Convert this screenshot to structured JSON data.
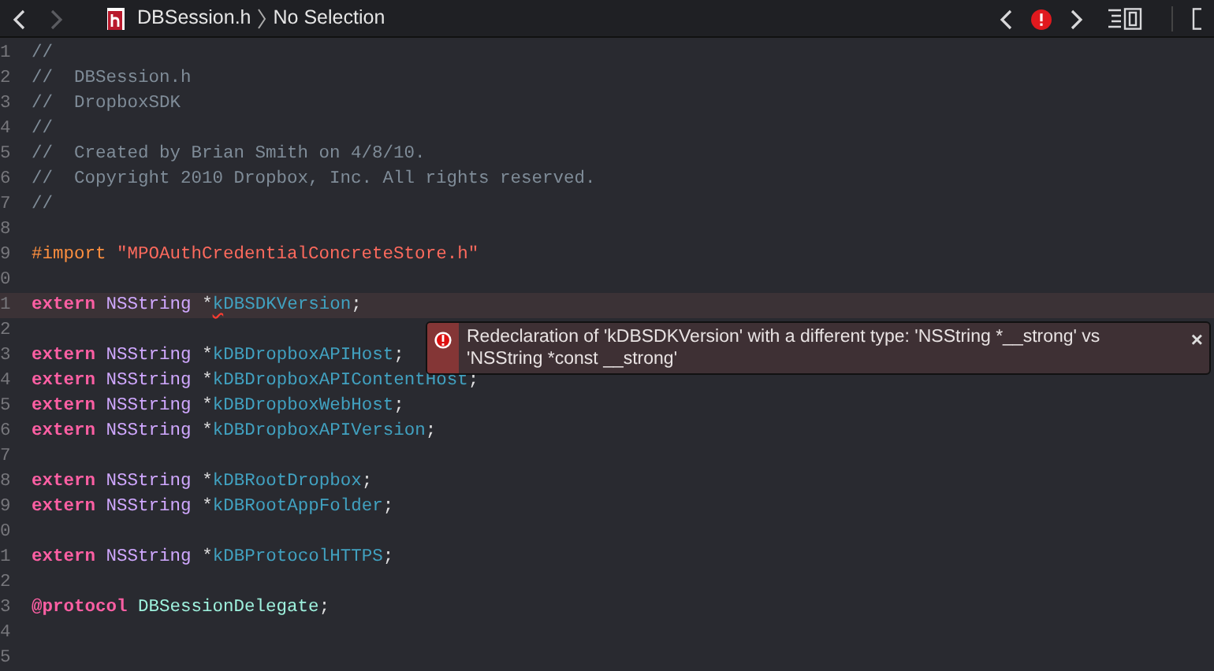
{
  "toolbar": {
    "back": {
      "disabled": false
    },
    "forward": {
      "disabled": true
    },
    "breadcrumb": [
      "DBSession.h",
      "No Selection"
    ]
  },
  "lines": [
    {
      "number": "1",
      "highlighted": false,
      "tokens": [
        {
          "kind": "comment",
          "text": "//"
        }
      ]
    },
    {
      "number": "2",
      "highlighted": false,
      "tokens": [
        {
          "kind": "comment",
          "text": "//  DBSession.h"
        }
      ]
    },
    {
      "number": "3",
      "highlighted": false,
      "tokens": [
        {
          "kind": "comment",
          "text": "//  DropboxSDK"
        }
      ]
    },
    {
      "number": "4",
      "highlighted": false,
      "tokens": [
        {
          "kind": "comment",
          "text": "//"
        }
      ]
    },
    {
      "number": "5",
      "highlighted": false,
      "tokens": [
        {
          "kind": "comment",
          "text": "//  Created by Brian Smith on 4/8/10."
        }
      ]
    },
    {
      "number": "6",
      "highlighted": false,
      "tokens": [
        {
          "kind": "comment",
          "text": "//  Copyright 2010 Dropbox, Inc. All rights reserved."
        }
      ]
    },
    {
      "number": "7",
      "highlighted": false,
      "tokens": [
        {
          "kind": "comment",
          "text": "//"
        }
      ]
    },
    {
      "number": "8",
      "highlighted": false
    },
    {
      "number": "9",
      "highlighted": false,
      "tokens": [
        {
          "kind": "preproc",
          "text": "#import"
        },
        {
          "kind": "string",
          "text": "\"MPOAuthCredentialConcreteStore.h\""
        }
      ]
    },
    {
      "number": "0",
      "highlighted": false
    },
    {
      "number": "1",
      "highlighted": true,
      "tokens": [
        {
          "kind": "keyword",
          "text": "extern"
        },
        {
          "kind": "type",
          "text": "NSString"
        },
        {
          "kind": "pointer",
          "text": "*"
        },
        {
          "kind": "ident",
          "text": "k",
          "squiggle": true
        },
        {
          "kind": "ident",
          "text": "DBSDKVersion"
        },
        {
          "kind": "punct",
          "text": ";"
        }
      ]
    },
    {
      "number": "2",
      "highlighted": false
    },
    {
      "number": "3",
      "highlighted": false,
      "tokens": [
        {
          "kind": "keyword",
          "text": "extern"
        },
        {
          "kind": "type",
          "text": "NSString"
        },
        {
          "kind": "pointer",
          "text": "*"
        },
        {
          "kind": "ident",
          "text": "kDBDropboxAPIHost"
        },
        {
          "kind": "punct",
          "text": ";"
        }
      ]
    },
    {
      "number": "4",
      "highlighted": false,
      "tokens": [
        {
          "kind": "keyword",
          "text": "extern"
        },
        {
          "kind": "type",
          "text": "NSString"
        },
        {
          "kind": "pointer",
          "text": "*"
        },
        {
          "kind": "ident",
          "text": "kDBDropboxAPIContentHost"
        },
        {
          "kind": "punct",
          "text": ";"
        }
      ]
    },
    {
      "number": "5",
      "highlighted": false,
      "tokens": [
        {
          "kind": "keyword",
          "text": "extern"
        },
        {
          "kind": "type",
          "text": "NSString"
        },
        {
          "kind": "pointer",
          "text": "*"
        },
        {
          "kind": "ident",
          "text": "kDBDropboxWebHost"
        },
        {
          "kind": "punct",
          "text": ";"
        }
      ]
    },
    {
      "number": "6",
      "highlighted": false,
      "tokens": [
        {
          "kind": "keyword",
          "text": "extern"
        },
        {
          "kind": "type",
          "text": "NSString"
        },
        {
          "kind": "pointer",
          "text": "*"
        },
        {
          "kind": "ident",
          "text": "kDBDropboxAPIVersion"
        },
        {
          "kind": "punct",
          "text": ";"
        }
      ]
    },
    {
      "number": "7",
      "highlighted": false
    },
    {
      "number": "8",
      "highlighted": false,
      "tokens": [
        {
          "kind": "keyword",
          "text": "extern"
        },
        {
          "kind": "type",
          "text": "NSString"
        },
        {
          "kind": "pointer",
          "text": "*"
        },
        {
          "kind": "ident",
          "text": "kDBRootDropbox"
        },
        {
          "kind": "punct",
          "text": ";"
        }
      ]
    },
    {
      "number": "9",
      "highlighted": false,
      "tokens": [
        {
          "kind": "keyword",
          "text": "extern"
        },
        {
          "kind": "type",
          "text": "NSString"
        },
        {
          "kind": "pointer",
          "text": "*"
        },
        {
          "kind": "ident",
          "text": "kDBRootAppFolder"
        },
        {
          "kind": "punct",
          "text": ";"
        }
      ]
    },
    {
      "number": "0",
      "highlighted": false
    },
    {
      "number": "1",
      "highlighted": false,
      "tokens": [
        {
          "kind": "keyword",
          "text": "extern"
        },
        {
          "kind": "type",
          "text": "NSString"
        },
        {
          "kind": "pointer",
          "text": "*"
        },
        {
          "kind": "ident",
          "text": "kDBProtocolHTTPS"
        },
        {
          "kind": "punct",
          "text": ";"
        }
      ]
    },
    {
      "number": "2",
      "highlighted": false
    },
    {
      "number": "3",
      "highlighted": false,
      "tokens": [
        {
          "kind": "keyword",
          "text": "@protocol"
        },
        {
          "kind": "class",
          "text": "DBSessionDelegate"
        },
        {
          "kind": "punct",
          "text": ";"
        }
      ]
    },
    {
      "number": "4",
      "highlighted": false
    },
    {
      "number": "5",
      "highlighted": false
    }
  ],
  "error_popup": {
    "message": "Redeclaration of 'kDBSDKVersion' with a different type: 'NSString *__strong' vs 'NSString *const __strong'",
    "close": "×"
  }
}
